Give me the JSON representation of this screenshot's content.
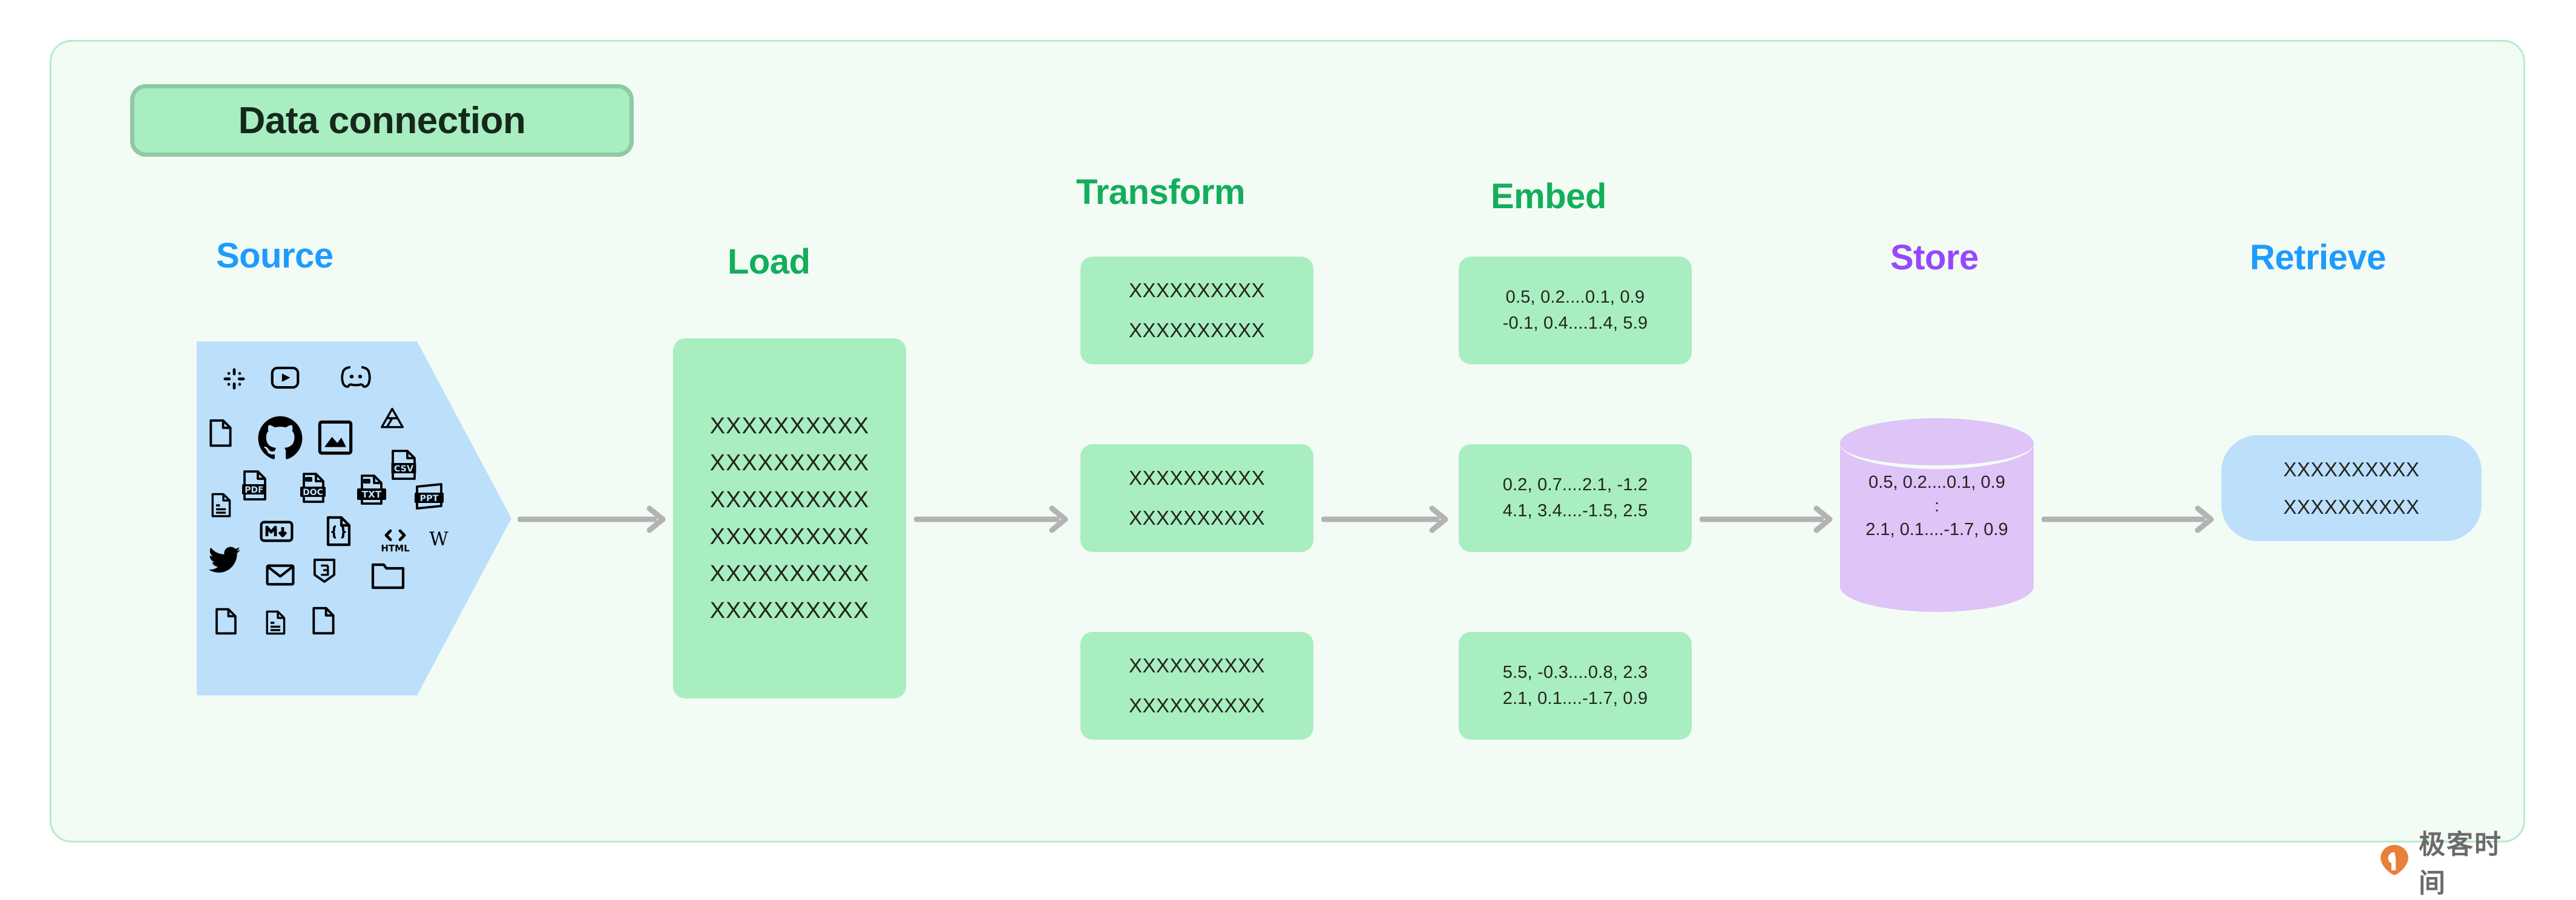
{
  "title": {
    "label": "Data connection"
  },
  "colors": {
    "container_bg": "#F2FCF4",
    "container_border": "#B7EBC8",
    "title_pill_bg": "#A8EEC0",
    "title_pill_border": "#8FC9A5",
    "green_card": "#A8EEC0",
    "blue_shape": "#BCDFFB",
    "purple_cylinder": "#DEC4F7",
    "heading_blue": "#1E9BFF",
    "heading_green": "#13AE5C",
    "heading_purple": "#9747FF",
    "arrow_gray": "#B3B3B3",
    "text_dark": "#22251F",
    "watermark_orange": "#E8803A",
    "watermark_gray": "#6B6B6B"
  },
  "stages": {
    "source": {
      "heading": "Source"
    },
    "load": {
      "heading": "Load"
    },
    "transform": {
      "heading": "Transform"
    },
    "embed": {
      "heading": "Embed"
    },
    "store": {
      "heading": "Store"
    },
    "retrieve": {
      "heading": "Retrieve"
    }
  },
  "source_icons": [
    "slack-icon",
    "youtube-icon",
    "discord-icon",
    "file-icon",
    "github-icon",
    "image-icon",
    "google-drive-icon",
    "file-lines-icon",
    "pdf-file-icon",
    "doc-file-icon",
    "txt-file-icon",
    "csv-file-icon",
    "ppt-file-icon",
    "markdown-icon",
    "json-file-icon",
    "html-icon",
    "wikipedia-icon",
    "twitter-icon",
    "email-icon",
    "css3-icon",
    "folder-icon",
    "file-icon-2",
    "file-lines-icon-2",
    "file-icon-3"
  ],
  "load": {
    "lines": [
      "XXXXXXXXXX",
      "XXXXXXXXXX",
      "XXXXXXXXXX",
      "XXXXXXXXXX",
      "XXXXXXXXXX",
      "XXXXXXXXXX"
    ]
  },
  "transform": {
    "boxes": [
      {
        "lines": [
          "XXXXXXXXXX",
          "XXXXXXXXXX"
        ]
      },
      {
        "lines": [
          "XXXXXXXXXX",
          "XXXXXXXXXX"
        ]
      },
      {
        "lines": [
          "XXXXXXXXXX",
          "XXXXXXXXXX"
        ]
      }
    ]
  },
  "embed": {
    "boxes": [
      {
        "lines": [
          "0.5, 0.2....0.1, 0.9",
          "-0.1, 0.4....1.4, 5.9"
        ]
      },
      {
        "lines": [
          "0.2, 0.7....2.1, -1.2",
          "4.1, 3.4....-1.5, 2.5"
        ]
      },
      {
        "lines": [
          "5.5, -0.3....0.8, 2.3",
          "2.1, 0.1....-1.7, 0.9"
        ]
      }
    ]
  },
  "store": {
    "lines": [
      "0.5, 0.2....0.1, 0.9",
      ":",
      "2.1, 0.1....-1.7, 0.9"
    ]
  },
  "retrieve": {
    "lines": [
      "XXXXXXXXXX",
      "XXXXXXXXXX"
    ]
  },
  "watermark": {
    "text": "极客时间"
  }
}
